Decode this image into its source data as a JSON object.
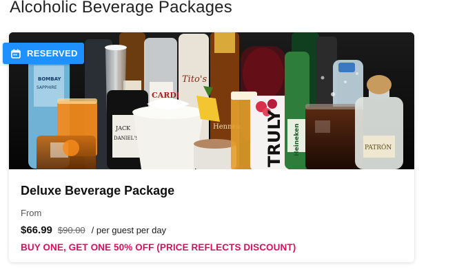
{
  "page": {
    "title": "Alcoholic Beverage Packages"
  },
  "card": {
    "badge": {
      "label": "RESERVED",
      "icon": "calendar-icon",
      "color": "#1e90ff"
    },
    "image": {
      "bottle_labels": [
        "BOMBAY SAPPHIRE",
        "CARDI",
        "Tito's",
        "JACK DANIEL'S",
        "TRULY",
        "Heineken",
        "Hennessy",
        "PATRÓN"
      ]
    },
    "title": "Deluxe Beverage Package",
    "from_label": "From",
    "price": {
      "current": "$66.99",
      "original": "$90.00",
      "unit": "/ per guest per day"
    },
    "promo": "BUY ONE, GET ONE 50% OFF (PRICE REFLECTS DISCOUNT)",
    "promo_color": "#d6105e"
  }
}
